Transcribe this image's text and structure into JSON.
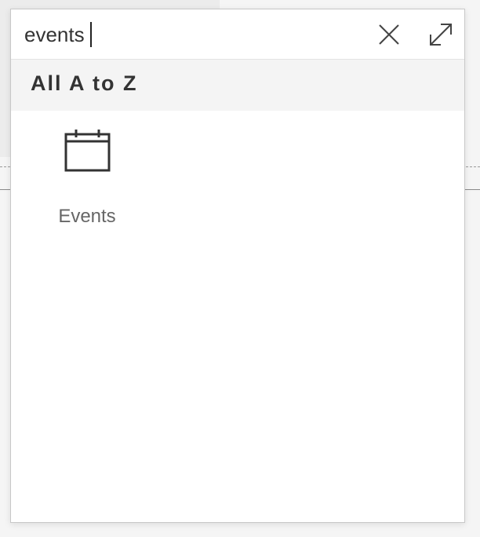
{
  "search": {
    "value": "events",
    "clear_icon": "close-icon",
    "expand_icon": "expand-icon"
  },
  "section": {
    "title": "All A to Z"
  },
  "results": [
    {
      "label": "Events",
      "icon": "calendar-icon"
    }
  ],
  "colors": {
    "text": "#333333",
    "label": "#666666",
    "header_bg": "#f4f4f4",
    "panel_border": "#c8c8c8"
  }
}
